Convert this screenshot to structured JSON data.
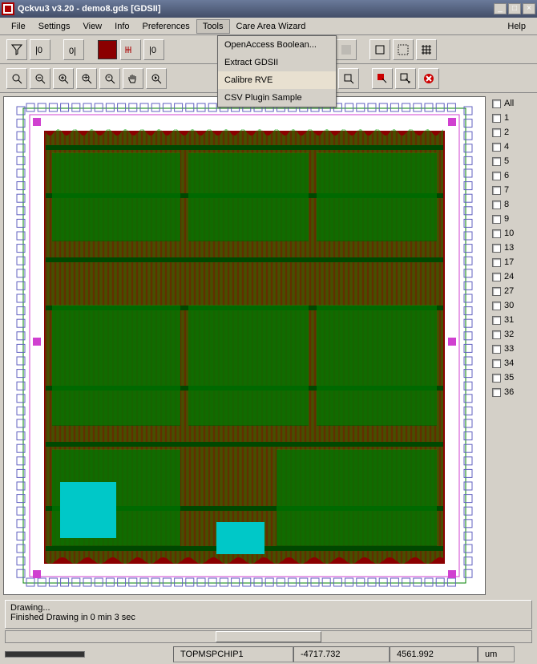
{
  "titlebar": {
    "title": "Qckvu3 v3.20 - demo8.gds [GDSII]"
  },
  "menubar": {
    "items": [
      "File",
      "Settings",
      "View",
      "Info",
      "Preferences",
      "Tools",
      "Care Area Wizard"
    ],
    "help": "Help",
    "open_index": 5
  },
  "tools_dropdown": {
    "items": [
      "OpenAccess Boolean...",
      "Extract GDSII",
      "Calibre RVE",
      "CSV Plugin Sample"
    ],
    "hover_index": 2
  },
  "toolbar1": {
    "buttons": [
      "filter-icon",
      "zero-small-icon",
      "zero-large-icon",
      "color-swatch",
      "ruler-icon",
      "pipe-zero-icon"
    ],
    "buttons2": [
      "rect-x-icon",
      "rect-corner-icon",
      "rect-corner2-icon",
      "pattern-icon",
      "rect-outline-icon",
      "pattern-dense-icon",
      "pattern-grid-icon"
    ]
  },
  "toolbar2": {
    "zoom_buttons": [
      "zoom-fit-icon",
      "zoom-out-icon",
      "zoom-in-icon",
      "zoom-plus-icon",
      "zoom-minus-icon",
      "pan-icon",
      "zoom-prev-icon"
    ],
    "right_buttons": [
      "arrow-q-right-icon",
      "arrow-q-left-icon",
      "crop-icon",
      "select-red-icon",
      "select-arrow-icon",
      "close-red-icon"
    ]
  },
  "layers": {
    "all_label": "All",
    "items": [
      "1",
      "2",
      "4",
      "5",
      "6",
      "7",
      "8",
      "9",
      "10",
      "13",
      "17",
      "24",
      "27",
      "30",
      "31",
      "32",
      "33",
      "34",
      "35",
      "36"
    ]
  },
  "status": {
    "line1": "Drawing...",
    "line2": "Finished Drawing in 0 min 3 sec"
  },
  "footer": {
    "cell_name": "TOPMSPCHIP1",
    "coord_x": "-4717.732",
    "coord_y": "4561.992",
    "units": "um"
  },
  "canvas": {
    "bg": "#ffffff",
    "wire_color": "#008000",
    "metal_color": "#8b0000",
    "pad_color": "#d040d0"
  }
}
